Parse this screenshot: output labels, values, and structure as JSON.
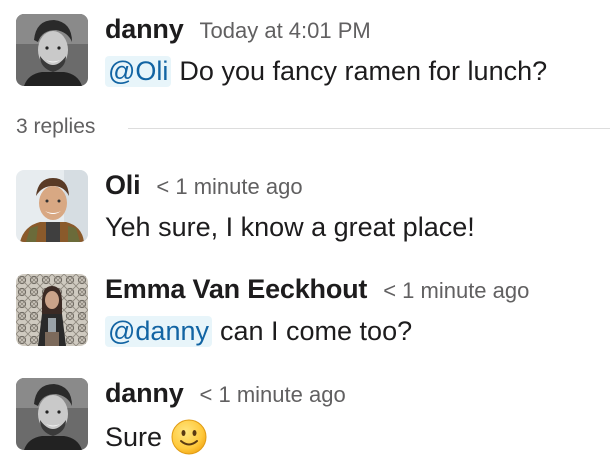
{
  "thread": {
    "parent": {
      "author": "danny",
      "timestamp": "Today at 4:01 PM",
      "mention": "@Oli",
      "text": "Do you fancy ramen for lunch?"
    },
    "replies_label": "3 replies",
    "replies": [
      {
        "author": "Oli",
        "timestamp": "< 1 minute ago",
        "text": "Yeh sure, I know a great place!"
      },
      {
        "author": "Emma Van Eeckhout",
        "timestamp": "< 1 minute ago",
        "mention": "@danny",
        "text": "can I come too?"
      },
      {
        "author": "danny",
        "timestamp": "< 1 minute ago",
        "text": "Sure",
        "emoji": "slightly-smiling-face-emoji"
      }
    ]
  },
  "colors": {
    "mention_bg": "#e8f5fa",
    "mention_text": "#1264a3",
    "timestamp": "#616061",
    "text": "#1d1c1d",
    "divider": "#dddddd"
  }
}
